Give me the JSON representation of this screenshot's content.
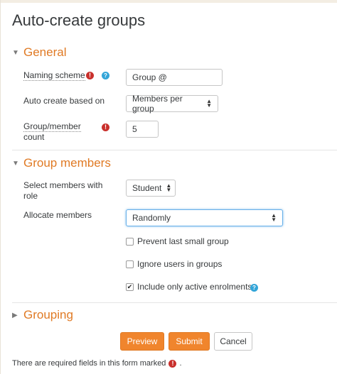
{
  "page": {
    "title": "Auto-create groups"
  },
  "sections": {
    "general": {
      "label": "General"
    },
    "group_members": {
      "label": "Group members"
    },
    "grouping": {
      "label": "Grouping"
    }
  },
  "fields": {
    "naming_scheme": {
      "label": "Naming scheme",
      "value": "Group @"
    },
    "auto_create": {
      "label": "Auto create based on",
      "value": "Members per group"
    },
    "count": {
      "label_line1": "Group/member",
      "label_line2": "count",
      "value": "5"
    },
    "select_members": {
      "label_line1": "Select members with",
      "label_line2": "role",
      "value": "Student"
    },
    "allocate": {
      "label": "Allocate members",
      "value": "Randomly"
    }
  },
  "checkboxes": {
    "prevent_last": {
      "label": "Prevent last small group",
      "checked": false
    },
    "ignore_users": {
      "label": "Ignore users in groups",
      "checked": false
    },
    "active_only": {
      "label": "Include only active enrolments",
      "checked": true
    }
  },
  "buttons": {
    "preview": "Preview",
    "submit": "Submit",
    "cancel": "Cancel"
  },
  "footer": {
    "note": "There are required fields in this form marked",
    "period": "."
  },
  "icons": {
    "required": "!",
    "help": "?",
    "caret_open": "▼",
    "caret_closed": "▶",
    "check": "✔"
  },
  "colors": {
    "accent": "#f0852d",
    "section_text": "#e07a24",
    "required": "#c9302c",
    "help": "#33a5d8"
  }
}
